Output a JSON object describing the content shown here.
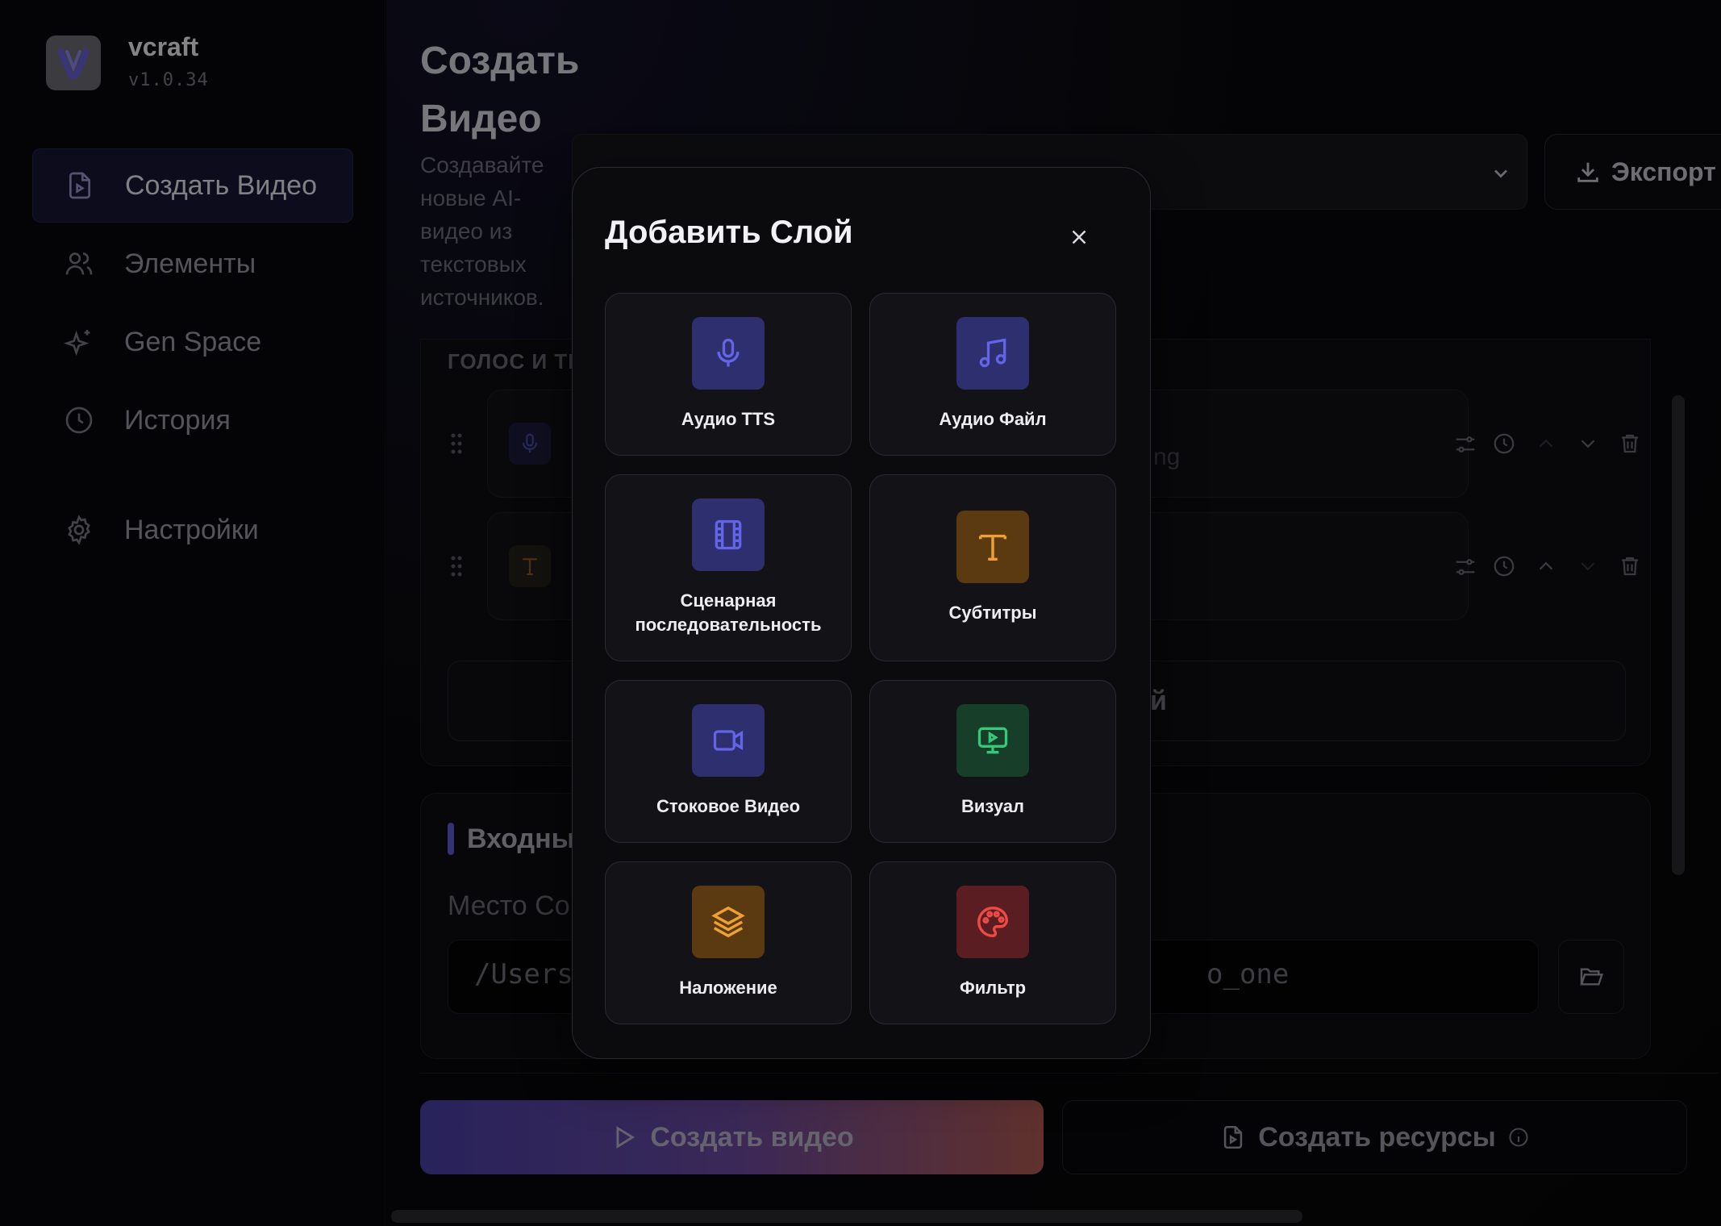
{
  "app": {
    "name": "vcraft",
    "version": "v1.0.34"
  },
  "sidebar": {
    "items": [
      {
        "label": "Создать Видео",
        "icon": "file-video-icon",
        "active": true
      },
      {
        "label": "Элементы",
        "icon": "users-icon"
      },
      {
        "label": "Gen Space",
        "icon": "sparkles-icon"
      },
      {
        "label": "История",
        "icon": "clock-icon"
      },
      {
        "label": "Настройки",
        "icon": "gear-icon"
      }
    ]
  },
  "main": {
    "title": "Создать Видео",
    "subtitle": "Создавайте новые AI-видео из текстовых источников.",
    "export_label": "Экспорт",
    "section_caption": "ГОЛОС И ТЕ",
    "layer_hint_1": "ng",
    "add_layer_label": "й",
    "panel2_title": "Входны",
    "field_label": "Место Со",
    "path_value": "/Users",
    "path_tail": "o_one",
    "create_video_label": "Создать видео",
    "create_resources_label": "Создать ресурсы"
  },
  "modal": {
    "title": "Добавить Слой",
    "tiles": [
      {
        "label": "Аудио TTS",
        "icon": "microphone-icon",
        "color": "#5b5bd6"
      },
      {
        "label": "Аудио Файл",
        "icon": "music-note-icon",
        "color": "#5b5bd6"
      },
      {
        "label": "Сценарная последовательность",
        "icon": "film-icon",
        "color": "#5b5bd6"
      },
      {
        "label": "Субтитры",
        "icon": "text-t-icon",
        "color": "#e8962a"
      },
      {
        "label": "Стоковое Видео",
        "icon": "video-camera-icon",
        "color": "#5b5bd6"
      },
      {
        "label": "Визуал",
        "icon": "monitor-play-icon",
        "color": "#2fbf6a"
      },
      {
        "label": "Наложение",
        "icon": "layers-icon",
        "color": "#e8962a"
      },
      {
        "label": "Фильтр",
        "icon": "palette-icon",
        "color": "#e0443e"
      }
    ]
  },
  "colors": {
    "accent": "#5b5bd6",
    "orange": "#e8962a",
    "green": "#2fbf6a",
    "red": "#e0443e"
  }
}
